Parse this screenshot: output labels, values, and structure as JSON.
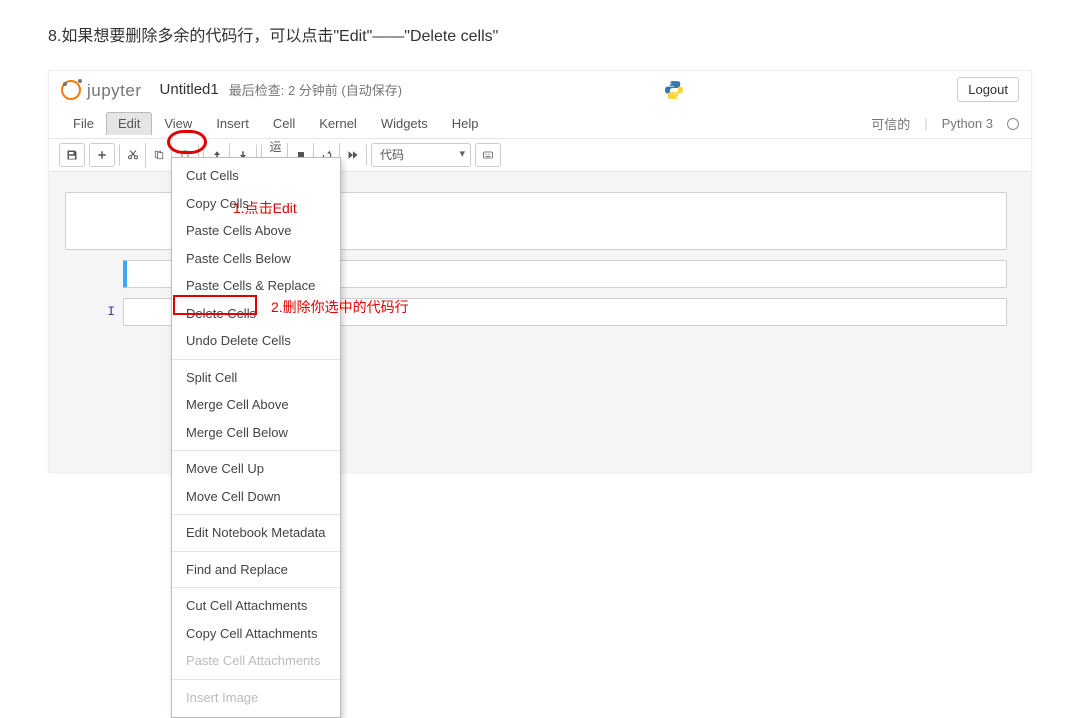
{
  "instruction_text": "8.如果想要删除多余的代码行，可以点击\"Edit\"——\"Delete cells\"",
  "header": {
    "jupyter_text": "jupyter",
    "notebook_title": "Untitled1",
    "checkpoint_text": "最后检查: 2 分钟前 (自动保存)",
    "logout_label": "Logout"
  },
  "menubar": {
    "items": [
      "File",
      "Edit",
      "View",
      "Insert",
      "Cell",
      "Kernel",
      "Widgets",
      "Help"
    ],
    "trusted_label": "可信的",
    "kernel_name": "Python 3"
  },
  "annotations": {
    "a1": "1.点击Edit",
    "a2": "2.删除你选中的代码行"
  },
  "toolbar": {
    "run_label": "运行",
    "celltype_value": "代码"
  },
  "edit_menu": {
    "groups": [
      {
        "items": [
          "Cut Cells",
          "Copy Cells",
          "Paste Cells Above",
          "Paste Cells Below",
          "Paste Cells & Replace",
          "Delete Cells",
          "Undo Delete Cells"
        ],
        "disabled": []
      },
      {
        "items": [
          "Split Cell",
          "Merge Cell Above",
          "Merge Cell Below"
        ],
        "disabled": []
      },
      {
        "items": [
          "Move Cell Up",
          "Move Cell Down"
        ],
        "disabled": []
      },
      {
        "items": [
          "Edit Notebook Metadata"
        ],
        "disabled": []
      },
      {
        "items": [
          "Find and Replace"
        ],
        "disabled": []
      },
      {
        "items": [
          "Cut Cell Attachments",
          "Copy Cell Attachments",
          "Paste Cell Attachments"
        ],
        "disabled": [
          "Paste Cell Attachments"
        ]
      },
      {
        "items": [
          "Insert Image"
        ],
        "disabled": [
          "Insert Image"
        ]
      }
    ]
  },
  "prompts": {
    "in_label": "I",
    "empty": ""
  }
}
